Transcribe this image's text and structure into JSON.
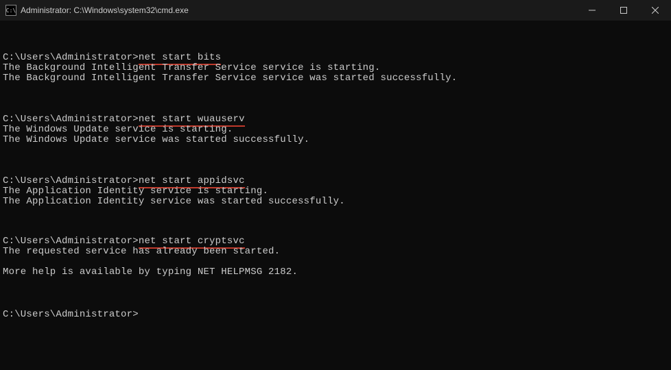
{
  "window": {
    "title": "Administrator: C:\\Windows\\system32\\cmd.exe",
    "icon_label": "cmd-icon"
  },
  "prompt": "C:\\Users\\Administrator>",
  "commands": {
    "bits": {
      "cmd": "net start bits",
      "out1": "The Background Intelligent Transfer Service service is starting.",
      "out2": "The Background Intelligent Transfer Service service was started successfully."
    },
    "wuauserv": {
      "cmd": "net start wuauserv",
      "out1": "The Windows Update service is starting.",
      "out2": "The Windows Update service was started successfully."
    },
    "appidsvc": {
      "cmd": "net start appidsvc",
      "out1": "The Application Identity service is starting.",
      "out2": "The Application Identity service was started successfully."
    },
    "cryptsvc": {
      "cmd": "net start cryptsvc",
      "out1": "The requested service has already been started.",
      "out2": "More help is available by typing NET HELPMSG 2182."
    }
  }
}
